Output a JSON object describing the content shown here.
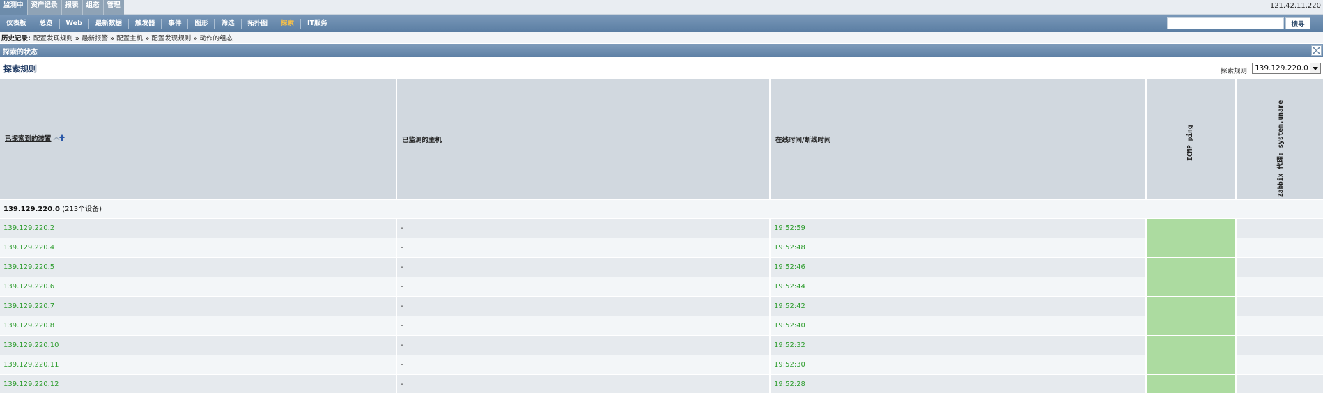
{
  "top_tabs": [
    "监测中",
    "资产记录",
    "报表",
    "组态",
    "管理"
  ],
  "server_ip": "121.42.11.220",
  "menu": [
    "仪表板",
    "总览",
    "Web",
    "最新数据",
    "触发器",
    "事件",
    "图形",
    "筛选",
    "拓扑图",
    "探索",
    "IT服务"
  ],
  "active_menu_index": 9,
  "search": {
    "value": "",
    "button_label": "搜寻"
  },
  "history": {
    "label": "历史记录:",
    "separator": "»",
    "items": [
      "配置发现规则",
      "最新报警",
      "配置主机",
      "配置发现规则",
      "动作的组态"
    ]
  },
  "section_title": "探索的状态",
  "page_title": "探索规则",
  "rule_filter": {
    "label": "探索规则",
    "selected": "139.129.220.0"
  },
  "columns": {
    "discovered_device": "已探索到的装置",
    "monitored_host": "已监测的主机",
    "uptime": "在线时间/断线时间",
    "icmp": "ICMP ping",
    "agent": "Zabbix 代理: system.uname"
  },
  "group": {
    "name": "139.129.220.0",
    "count_text": "(213个设备)"
  },
  "rows": [
    {
      "ip": "139.129.220.2",
      "host": "-",
      "time": "19:52:59"
    },
    {
      "ip": "139.129.220.4",
      "host": "-",
      "time": "19:52:48"
    },
    {
      "ip": "139.129.220.5",
      "host": "-",
      "time": "19:52:46"
    },
    {
      "ip": "139.129.220.6",
      "host": "-",
      "time": "19:52:44"
    },
    {
      "ip": "139.129.220.7",
      "host": "-",
      "time": "19:52:42"
    },
    {
      "ip": "139.129.220.8",
      "host": "-",
      "time": "19:52:40"
    },
    {
      "ip": "139.129.220.10",
      "host": "-",
      "time": "19:52:32"
    },
    {
      "ip": "139.129.220.11",
      "host": "-",
      "time": "19:52:30"
    },
    {
      "ip": "139.129.220.12",
      "host": "-",
      "time": "19:52:28"
    }
  ],
  "colors": {
    "up_text": "#2f9d2f",
    "ping_up": "#acdba0",
    "header_bg": "#d1d8df",
    "menu_bg": "#6989ad",
    "active_menu": "#f5c04a"
  }
}
